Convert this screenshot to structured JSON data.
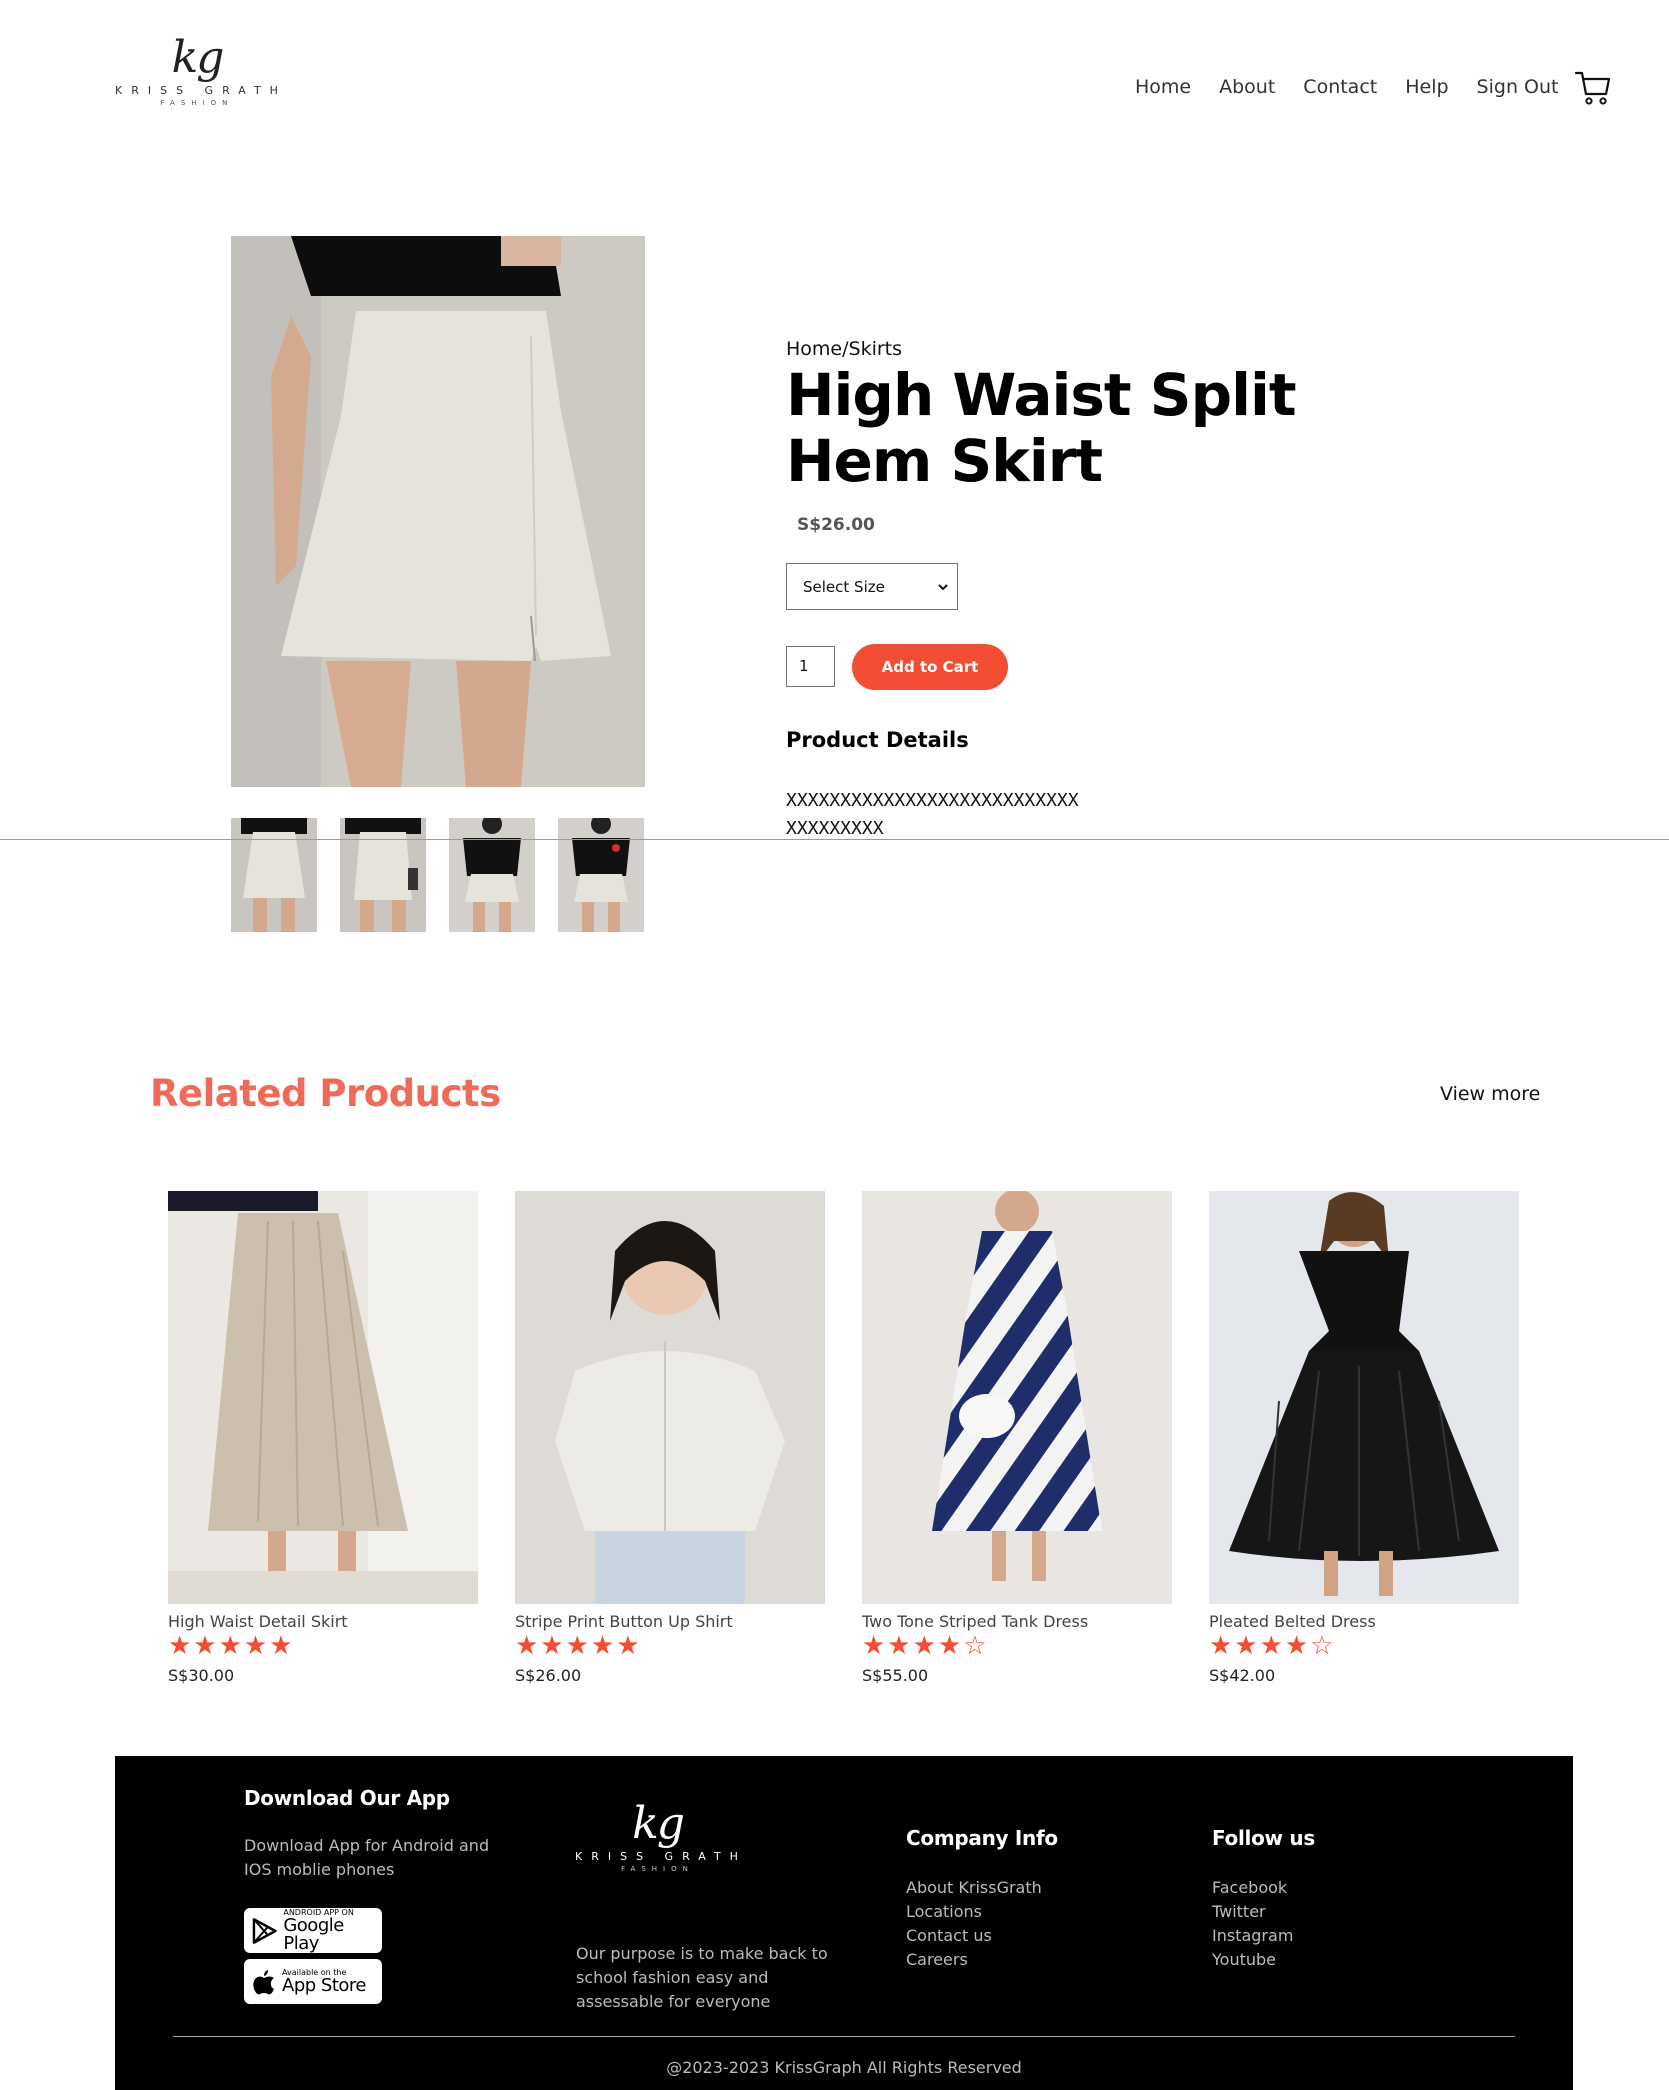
{
  "brand": {
    "mark": "kg",
    "name": "KRISS GRATH",
    "sub": "FASHION"
  },
  "nav": {
    "items": [
      "Home",
      "About",
      "Contact",
      "Help",
      "Sign Out"
    ],
    "cart_icon": "cart-icon"
  },
  "product": {
    "breadcrumb": "Home/Skirts",
    "title": "High Waist Split Hem Skirt",
    "price": "S$26.00",
    "size_select": "Select Size",
    "quantity": "1",
    "add_to_cart": "Add to Cart",
    "details_heading": "Product Details",
    "details_text": "XXXXXXXXXXXXXXXXXXXXXXXXXXXXXXXXXXXX"
  },
  "related": {
    "title": "Related Products",
    "view_more": "View more",
    "items": [
      {
        "name": "High Waist Detail Skirt",
        "rating": 5,
        "stars": "★★★★★",
        "price": "S$30.00"
      },
      {
        "name": "Stripe Print Button Up Shirt",
        "rating": 5,
        "stars": "★★★★★",
        "price": "S$26.00"
      },
      {
        "name": "Two Tone Striped Tank Dress",
        "rating": 4,
        "stars": "★★★★☆",
        "price": "S$55.00"
      },
      {
        "name": "Pleated Belted Dress",
        "rating": 4,
        "stars": "★★★★☆",
        "price": "S$42.00"
      }
    ]
  },
  "footer": {
    "app_heading": "Download Our App",
    "app_text": "Download App for Android and IOS moblie phones",
    "google_small": "ANDROID APP ON",
    "google_big": "Google Play",
    "apple_small": "Available on the",
    "apple_big": "App Store",
    "purpose": "Our purpose is to make back to school fashion easy and assessable for everyone",
    "company_heading": "Company Info",
    "company_links": [
      "About KrissGrath",
      "Locations",
      "Contact us",
      "Careers"
    ],
    "follow_heading": "Follow us",
    "follow_links": [
      "Facebook",
      "Twitter",
      "Instagram",
      "Youtube"
    ],
    "copyright": "@2023-2023 KrissGraph All Rights Reserved"
  },
  "colors": {
    "accent": "#f24e34",
    "related_title": "#ef6a59",
    "footer_bg": "#000000"
  }
}
